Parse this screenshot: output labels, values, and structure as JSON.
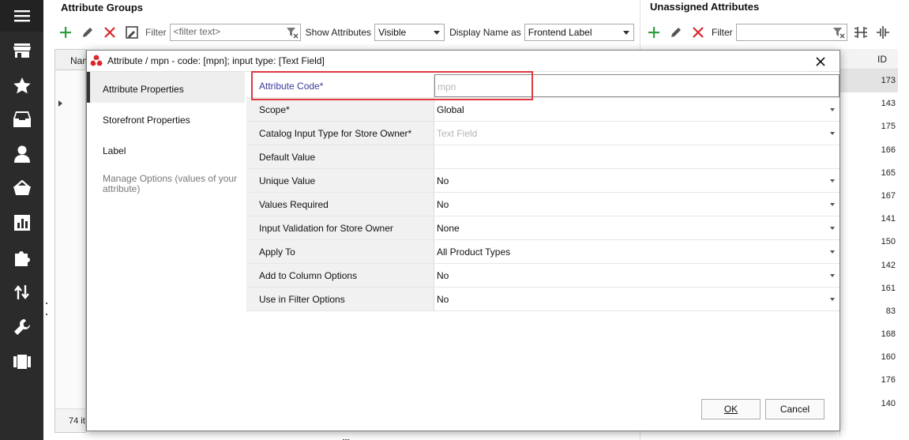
{
  "sidebar": {
    "items": [
      "menu-icon",
      "store-icon",
      "star-icon",
      "inbox-icon",
      "user-icon",
      "basket-icon",
      "chart-icon",
      "puzzle-icon",
      "sync-arrows-icon",
      "wrench-icon",
      "cards-icon"
    ]
  },
  "left_panel": {
    "title": "Attribute Groups",
    "filter_label": "Filter",
    "filter_placeholder": "<filter text>",
    "show_attributes_label": "Show Attributes",
    "show_attributes_value": "Visible",
    "display_name_label": "Display Name as",
    "display_name_value": "Frontend Label",
    "grid_header": "Nam",
    "grid_footer": "74 it"
  },
  "right_panel": {
    "title": "Unassigned Attributes",
    "filter_label": "Filter",
    "id_header": "ID",
    "ids": [
      "173",
      "143",
      "175",
      "166",
      "165",
      "167",
      "141",
      "150",
      "142",
      "161",
      "83",
      "168",
      "160",
      "176",
      "140"
    ]
  },
  "dialog": {
    "title": "Attribute / mpn - code: [mpn]; input type: [Text Field]",
    "tabs": [
      {
        "label": "Attribute Properties"
      },
      {
        "label": "Storefront Properties"
      },
      {
        "label": "Label"
      },
      {
        "label": "Manage Options (values of your attribute)"
      }
    ],
    "properties": [
      {
        "name": "Attribute Code*",
        "value": "mpn"
      },
      {
        "name": "Scope*",
        "value": "Global"
      },
      {
        "name": "Catalog Input Type for Store Owner*",
        "value": "Text Field"
      },
      {
        "name": "Default Value",
        "value": ""
      },
      {
        "name": "Unique Value",
        "value": "No"
      },
      {
        "name": "Values Required",
        "value": "No"
      },
      {
        "name": "Input Validation for Store Owner",
        "value": "None"
      },
      {
        "name": "Apply To",
        "value": "All Product Types"
      },
      {
        "name": "Add to Column Options",
        "value": "No"
      },
      {
        "name": "Use in Filter Options",
        "value": "No"
      }
    ],
    "ok_label": "OK",
    "cancel_label": "Cancel"
  },
  "colors": {
    "sidebar_bg": "#2b2b2b",
    "add_green": "#2e9e3a",
    "delete_red": "#d9262c",
    "highlight_red": "#e0393e",
    "link_blue": "#3a3a9c"
  }
}
